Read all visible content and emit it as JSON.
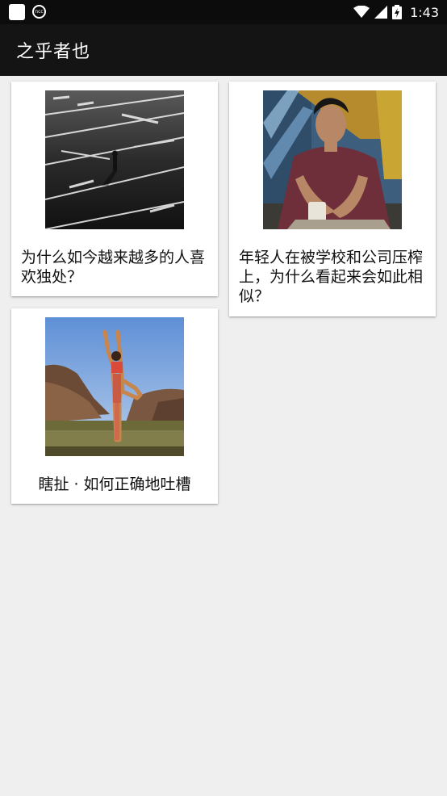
{
  "status_bar": {
    "time": "1:43",
    "left_icons": [
      "app-notification-icon",
      "ncc-icon"
    ],
    "right_icons": [
      "wifi-icon",
      "signal-icon",
      "battery-icon"
    ]
  },
  "app_bar": {
    "title": "之乎者也"
  },
  "cards": [
    {
      "title": "为什么如今越来越多的人喜欢独处？",
      "image": "parking-lot-person-image"
    },
    {
      "title": "年轻人在被学校和公司压榨上，为什么看起来会如此相似？",
      "image": "young-man-sitting-image"
    },
    {
      "title": "瞎扯 · 如何正确地吐槽",
      "image": "yoga-pose-image"
    }
  ]
}
